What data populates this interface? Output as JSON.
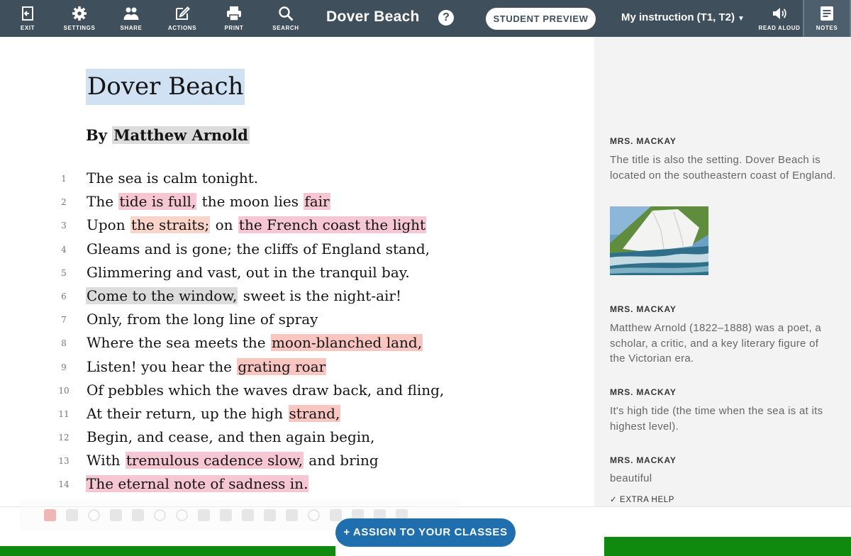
{
  "toolbar": {
    "exit_label": "EXIT",
    "settings_label": "SETTINGS",
    "share_label": "SHARE",
    "actions_label": "ACTIONS",
    "print_label": "PRINT",
    "search_label": "SEARCH",
    "doc_title": "Dover Beach",
    "help_glyph": "?",
    "student_preview_label": "STUDENT PREVIEW",
    "instruction_select": "My instruction (T1, T2)",
    "read_aloud_label": "READ ALOUD",
    "notes_label": "NOTES"
  },
  "poem": {
    "title": "Dover Beach",
    "byline_prefix": "By ",
    "author": "Matthew Arnold",
    "lines": [
      {
        "num": "1",
        "segments": [
          {
            "text": "The sea is calm tonight.",
            "hl": ""
          }
        ]
      },
      {
        "num": "2",
        "segments": [
          {
            "text": "The ",
            "hl": ""
          },
          {
            "text": "tide is full,",
            "hl": "pink"
          },
          {
            "text": " the moon lies ",
            "hl": ""
          },
          {
            "text": "fair",
            "hl": "pink"
          }
        ]
      },
      {
        "num": "3",
        "segments": [
          {
            "text": "Upon ",
            "hl": ""
          },
          {
            "text": "the straits;",
            "hl": "peach"
          },
          {
            "text": " on ",
            "hl": ""
          },
          {
            "text": "the French coast the light",
            "hl": "pink"
          }
        ]
      },
      {
        "num": "4",
        "segments": [
          {
            "text": "Gleams and is gone; the cliffs of England stand,",
            "hl": ""
          }
        ]
      },
      {
        "num": "5",
        "segments": [
          {
            "text": "Glimmering and vast, out in the tranquil bay.",
            "hl": ""
          }
        ]
      },
      {
        "num": "6",
        "segments": [
          {
            "text": "Come to the window,",
            "hl": "gray"
          },
          {
            "text": " sweet is the night-air!",
            "hl": ""
          }
        ]
      },
      {
        "num": "7",
        "segments": [
          {
            "text": "Only, from the long line of spray",
            "hl": ""
          }
        ]
      },
      {
        "num": "8",
        "segments": [
          {
            "text": "Where the sea meets the ",
            "hl": ""
          },
          {
            "text": "moon-blanched land,",
            "hl": "salmon"
          }
        ]
      },
      {
        "num": "9",
        "segments": [
          {
            "text": "Listen! you hear the ",
            "hl": ""
          },
          {
            "text": "grating roar",
            "hl": "salmon"
          }
        ]
      },
      {
        "num": "10",
        "segments": [
          {
            "text": "Of pebbles which the waves draw back, and fling,",
            "hl": ""
          }
        ]
      },
      {
        "num": "11",
        "segments": [
          {
            "text": "At their return, up the high ",
            "hl": ""
          },
          {
            "text": "strand,",
            "hl": "salmon"
          }
        ]
      },
      {
        "num": "12",
        "segments": [
          {
            "text": "Begin, and cease, and then again begin,",
            "hl": ""
          }
        ]
      },
      {
        "num": "13",
        "segments": [
          {
            "text": "With ",
            "hl": ""
          },
          {
            "text": "tremulous cadence slow,",
            "hl": "pink"
          },
          {
            "text": " and bring",
            "hl": ""
          }
        ]
      },
      {
        "num": "14",
        "segments": [
          {
            "text": "The eternal note of sadness in.",
            "hl": "pink"
          }
        ]
      }
    ]
  },
  "notes": [
    {
      "author": "MRS. MACKAY",
      "text": "The title is also the setting. Dover Beach is located on the southeastern coast of England."
    },
    {
      "author": "MRS. MACKAY",
      "text": "Matthew Arnold (1822–1888) was a poet, a scholar, a critic, and a key literary figure of the Victorian era."
    },
    {
      "author": "MRS. MACKAY",
      "text": "It's high tide (the time when the sea is at its highest level)."
    },
    {
      "author": "MRS. MACKAY",
      "text": "beautiful"
    }
  ],
  "extra_help_label": "EXTRA HELP",
  "assign_button_label": "+ ASSIGN TO YOUR CLASSES",
  "colors": {
    "toolbar_bg": "#3f4f5c",
    "title_highlight": "#cfe1f2",
    "highlight_pink": "#f7c6d3",
    "highlight_peach": "#fad4c8",
    "highlight_salmon": "#f8c5c1",
    "highlight_gray": "#dcdcdc",
    "assign_button": "#1f6fae",
    "footer_green": "#0f8a0f"
  }
}
